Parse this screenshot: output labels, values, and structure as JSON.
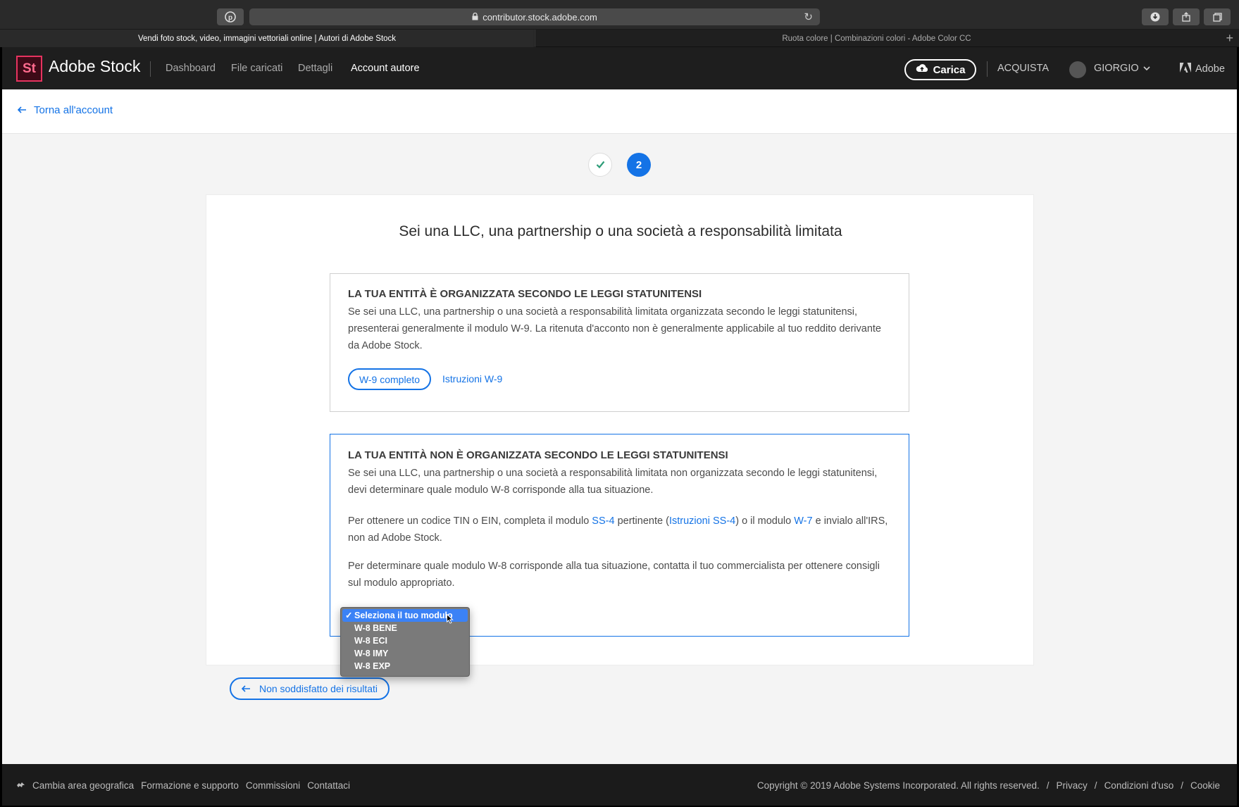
{
  "browser": {
    "url": "contributor.stock.adobe.com",
    "tabs": [
      {
        "title": "Vendi foto stock, video, immagini vettoriali online | Autori di Adobe Stock",
        "active": true
      },
      {
        "title": "Ruota colore | Combinazioni colori - Adobe Color CC",
        "active": false
      }
    ]
  },
  "header": {
    "logo": "St",
    "brand": "Adobe Stock",
    "nav": [
      "Dashboard",
      "File caricati",
      "Dettagli",
      "Account autore"
    ],
    "upload_label": "Carica",
    "buy_label": "ACQUISTA",
    "user_label": "GIORGIO",
    "adobe_label": "Adobe"
  },
  "back_link": "Torna all'account",
  "steps": {
    "done_icon": "check-icon",
    "current": "2"
  },
  "card": {
    "title": "Sei una LLC, una partnership o una società a responsabilità limitata",
    "option1": {
      "heading": "LA TUA ENTITÀ È ORGANIZZATA SECONDO LE LEGGI STATUNITENSI",
      "text": "Se sei una LLC, una partnership o una società a responsabilità limitata organizzata secondo le leggi statunitensi, presenterai generalmente il modulo W-9. La ritenuta d'acconto non è generalmente applicabile al tuo reddito derivante da Adobe Stock.",
      "button": "W-9 completo",
      "link": "Istruzioni W-9"
    },
    "option2": {
      "heading": "LA TUA ENTITÀ NON È ORGANIZZATA SECONDO LE LEGGI STATUNITENSI",
      "text1": "Se sei una LLC, una partnership o una società a responsabilità limitata non organizzata secondo le leggi statunitensi, devi determinare quale modulo W-8 corrisponde alla tua situazione.",
      "text2_a": "Per ottenere un codice TIN o EIN, completa il modulo ",
      "text2_link1": "SS-4",
      "text2_b": " pertinente (",
      "text2_link2": "Istruzioni SS-4",
      "text2_c": ") o il modulo ",
      "text2_link3": "W-7",
      "text2_d": " e invialo all'IRS, non ad Adobe Stock.",
      "text3": "Per determinare quale modulo W-8 corrisponde alla tua situazione, contatta il tuo commercialista per ottenere consigli sul modulo appropriato.",
      "select_options": [
        "Seleziona il tuo modulo",
        "W-8 BENE",
        "W-8 ECI",
        "W-8 IMY",
        "W-8 EXP"
      ],
      "selected_index": 0
    }
  },
  "secondary_button": "Non soddisfatto dei risultati",
  "footer": {
    "left": [
      "Cambia area geografica",
      "Formazione e supporto",
      "Commissioni",
      "Contattaci"
    ],
    "copyright": "Copyright © 2019 Adobe Systems Incorporated. All rights reserved.",
    "right": [
      "Privacy",
      "Condizioni d'uso",
      "Cookie"
    ]
  },
  "colors": {
    "accent": "#1473e6",
    "header_bg": "#1e1e1e",
    "logo": "#e6335f"
  }
}
